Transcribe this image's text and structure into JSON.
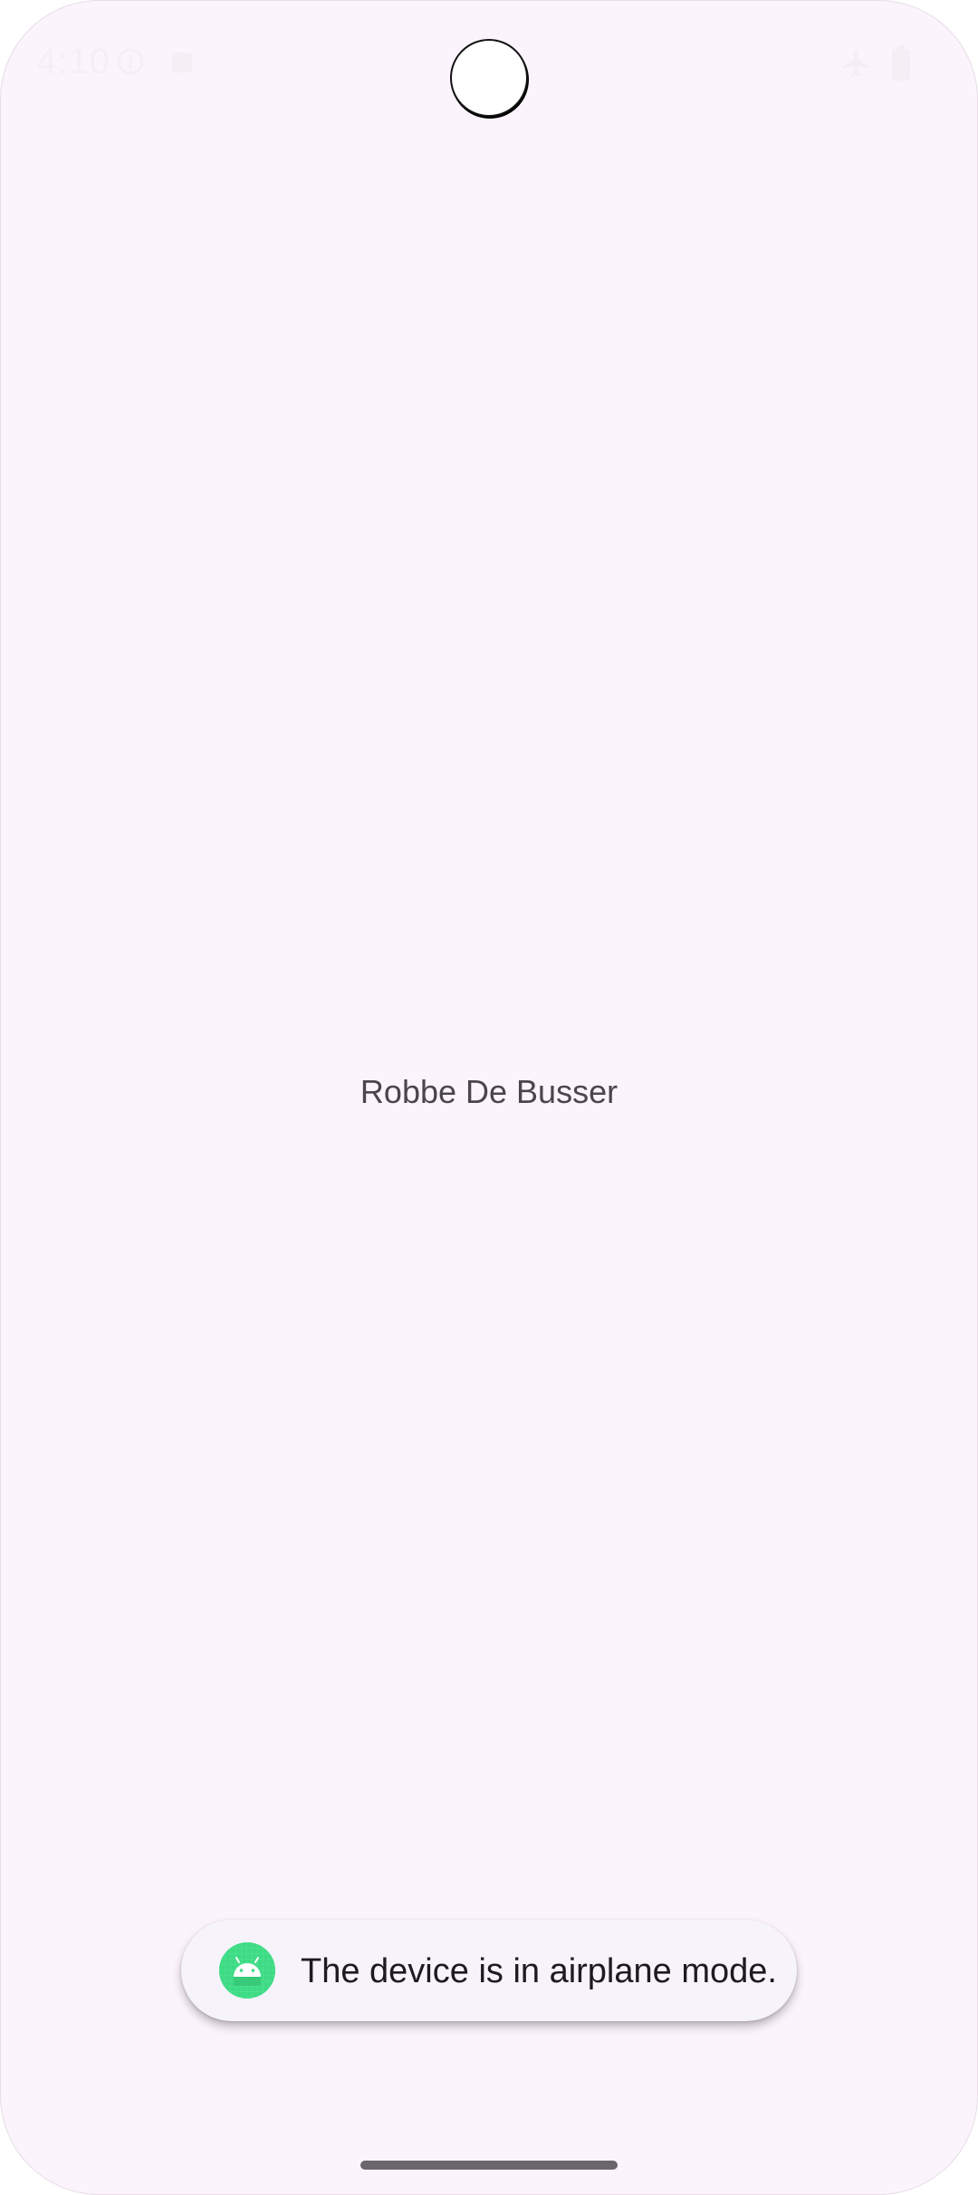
{
  "status_bar": {
    "time": "4:10",
    "icons": [
      "info-icon",
      "notification-square-icon",
      "airplane-icon",
      "battery-icon"
    ]
  },
  "main": {
    "name_text": "Robbe De Busser"
  },
  "toast": {
    "message": "The device is in airplane mode.",
    "app_icon": "android-icon",
    "icon_color": "#3ddc84"
  },
  "colors": {
    "background": "#fcf4fc",
    "text": "#4a454f",
    "toast_background": "#f6f3fa"
  }
}
